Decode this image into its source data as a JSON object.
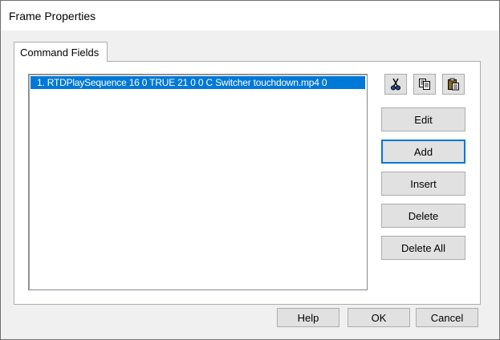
{
  "window": {
    "title": "Frame Properties"
  },
  "tabs": [
    {
      "label": "Command Fields",
      "selected": true
    }
  ],
  "command_list": {
    "items": [
      {
        "text": "1.  RTDPlaySequence 16 0 TRUE 21 0 0 C Switcher touchdown.mp4 0",
        "selected": true
      }
    ]
  },
  "toolbar": {
    "cut_icon": "scissors-icon",
    "copy_icon": "copy-icon",
    "paste_icon": "paste-icon"
  },
  "side_buttons": {
    "edit": "Edit",
    "add": "Add",
    "insert": "Insert",
    "delete": "Delete",
    "delete_all": "Delete All"
  },
  "footer_buttons": {
    "help": "Help",
    "ok": "OK",
    "cancel": "Cancel"
  },
  "colors": {
    "selection": "#0078d7",
    "button_face": "#e1e1e1",
    "dialog_bg": "#f0f0f0"
  }
}
